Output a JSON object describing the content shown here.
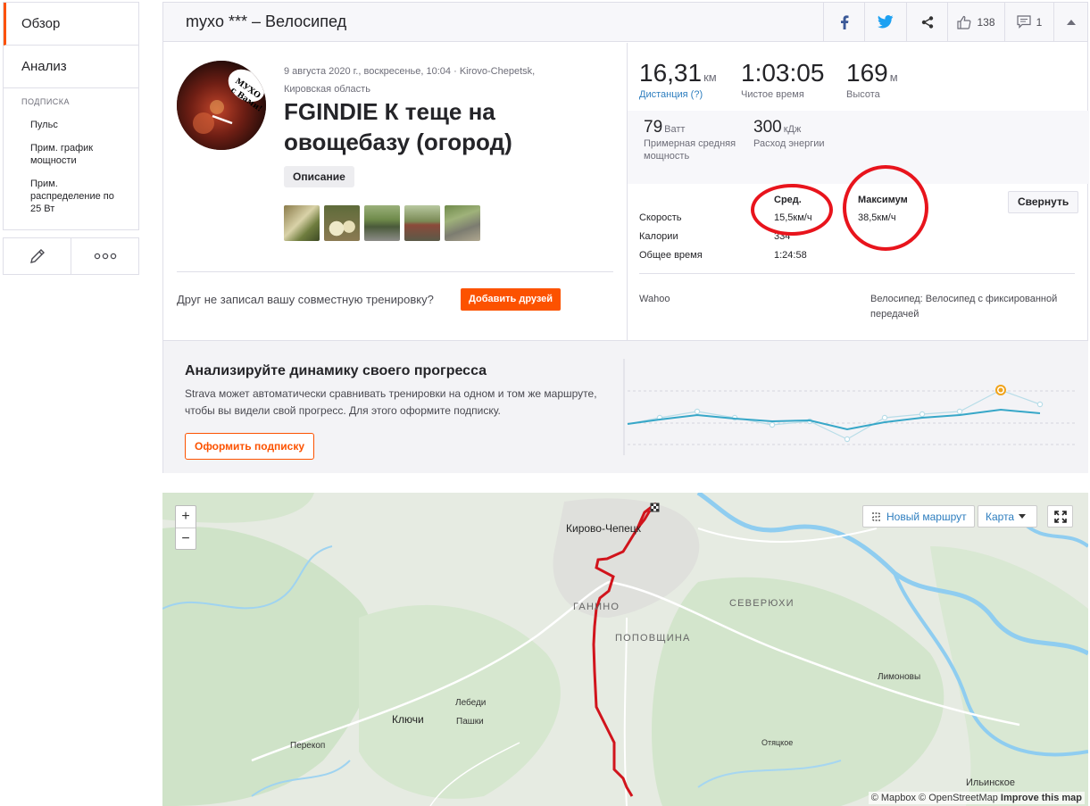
{
  "sidebar": {
    "tabs": [
      {
        "label": "Обзор",
        "active": true
      },
      {
        "label": "Анализ",
        "active": false
      }
    ],
    "subscription_header": "ПОДПИСКА",
    "items": [
      "Пульс",
      "Прим. график мощности",
      "Прим. распределение по 25 Вт"
    ],
    "actions": {
      "edit_icon": "pencil-icon",
      "more_icon": "ellipsis-icon"
    }
  },
  "header": {
    "title": "myxo *** – Велосипед",
    "likes": "138",
    "comments": "1"
  },
  "activity": {
    "meta_line1": "9 августа 2020 г., воскресенье, 10:04 · Kirovo-Chepetsk,",
    "meta_line2": "Кировская область",
    "name": "FGINDIE К теще на овощебазу (огород)",
    "description_button": "Описание",
    "friend_text": "Друг не записал вашу совместную тренировку?",
    "add_friends_button": "Добавить друзей"
  },
  "stats": {
    "distance": {
      "value": "16,31",
      "unit": "км",
      "label": "Дистанция (?)"
    },
    "moving_time": {
      "value": "1:03:05",
      "label": "Чистое время"
    },
    "elevation": {
      "value": "169",
      "unit": "м",
      "label": "Высота"
    },
    "power": {
      "value": "79",
      "unit": "Ватт",
      "label": "Примерная средняя мощность"
    },
    "energy": {
      "value": "300",
      "unit": "кДж",
      "label": "Расход энергии"
    }
  },
  "table": {
    "col_avg": "Сред.",
    "col_max": "Максимум",
    "collapse_button": "Свернуть",
    "rows": [
      {
        "label": "Скорость",
        "avg": "15,5км/ч",
        "max": "38,5км/ч"
      },
      {
        "label": "Калории",
        "avg": "334",
        "max": ""
      },
      {
        "label": "Общее время",
        "avg": "1:24:58",
        "max": ""
      }
    ],
    "device": "Wahoo",
    "bike": "Велосипед: Велосипед с фиксированной передачей"
  },
  "promo": {
    "title": "Анализируйте динамику своего прогресса",
    "text": "Strava может автоматически сравнивать тренировки на одном и том же маршруте, чтобы вы видели свой прогресс. Для этого оформите подписку.",
    "button": "Оформить подписку"
  },
  "map": {
    "new_route": "Новый маршрут",
    "map_type": "Карта",
    "labels": {
      "city": "Кирово-Чепецк",
      "ganino": "ГАНИНО",
      "popovshina": "ПОПОВЩИНА",
      "severyukhi": "СЕВЕРЮХИ",
      "limonovy": "Лимоновы",
      "lebedi": "Лебеди",
      "pashki": "Пашки",
      "klyuchi": "Ключи",
      "perekop": "Перекоп",
      "otyatskoe": "Отяцкое",
      "ilinskoe": "Ильинское"
    },
    "attribution": "© Mapbox © OpenStreetMap",
    "improve": "Improve this map",
    "colors": {
      "route": "#d1141c",
      "water": "#8fcdf0"
    }
  },
  "colors": {
    "accent": "#fc5200",
    "link": "#2e7ebf",
    "annotation": "#e8141c"
  }
}
